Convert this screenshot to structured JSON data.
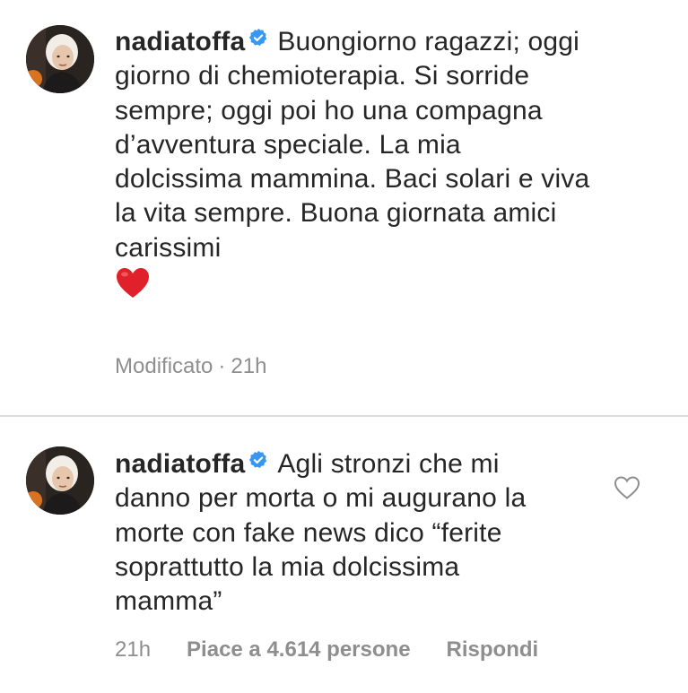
{
  "comments": [
    {
      "username": "nadiatoffa",
      "text": "Buongiorno ragazzi; oggi giorno di chemioterapia. Si sorride sempre; oggi poi ho una compagna d’avventura speciale. La mia dolcissima mammina. Baci solari e viva la vita sempre. Buona giornata amici carissimi",
      "emoji": "red-heart",
      "edited_label": "Modificato",
      "separator": "·",
      "time": "21h"
    },
    {
      "username": "nadiatoffa",
      "text": "Agli stronzi che mi danno per morta o mi augurano la morte con fake news dico “ferite soprattutto la mia dolcissima mamma”",
      "time": "21h",
      "likes_label": "Piace a 4.614 persone",
      "reply_label": "Rispondi",
      "like_icon": "heart-outline-icon"
    }
  ],
  "colors": {
    "text": "#262626",
    "meta": "#8e8e8e",
    "verified_blue": "#3897f0",
    "divider": "#dbdbdb",
    "heart_red": "#e0202a"
  }
}
